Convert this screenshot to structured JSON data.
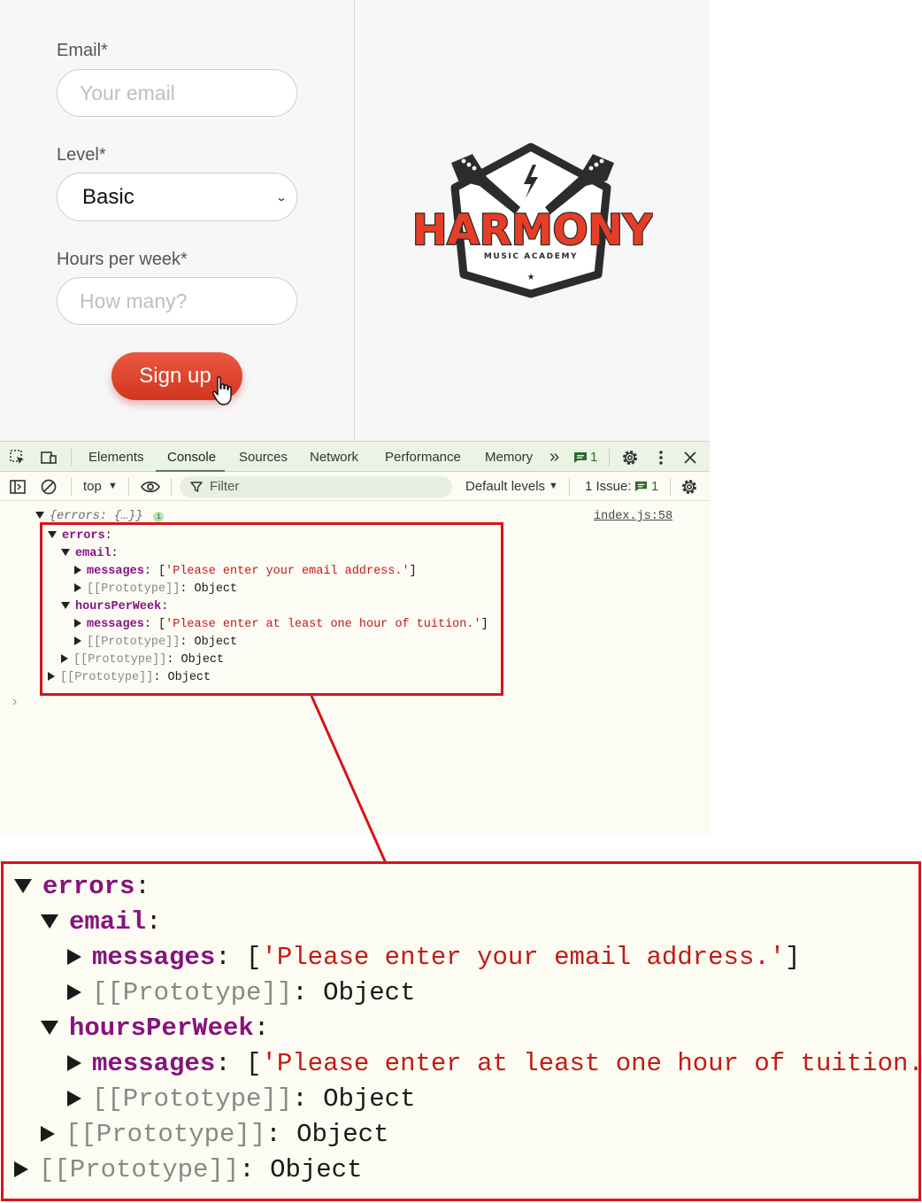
{
  "form": {
    "email_label": "Email*",
    "email_placeholder": "Your email",
    "level_label": "Level*",
    "level_value": "Basic",
    "hours_label": "Hours per week*",
    "hours_placeholder": "How many?",
    "signup_label": "Sign up"
  },
  "logo": {
    "brand": "HARMONY",
    "tagline": "MUSIC ACADEMY",
    "star": "★"
  },
  "devtools": {
    "tabs": [
      "Elements",
      "Console",
      "Sources",
      "Network",
      "Performance",
      "Memory"
    ],
    "active_tab": "Console",
    "more_tabs": "»",
    "message_count": "1",
    "toolbar": {
      "context": "top",
      "filter_placeholder": "Filter",
      "levels": "Default levels",
      "issues_label": "1 Issue:",
      "issues_count": "1"
    },
    "console": {
      "summary": "{errors: {…}}",
      "info_badge": "i",
      "source_link": "index.js:58",
      "prompt": "›",
      "rows": [
        {
          "key": "errors",
          "sep": ":",
          "value": "",
          "kind": "key",
          "arrow": "down",
          "indent": 0
        },
        {
          "key": "email",
          "sep": ":",
          "value": "",
          "kind": "key",
          "arrow": "down",
          "indent": 1
        },
        {
          "key": "messages",
          "sep": ": ",
          "value": "['Please enter your email address.']",
          "kind": "key",
          "arrow": "right",
          "indent": 2
        },
        {
          "key": "[[Prototype]]",
          "sep": ": ",
          "value": "Object",
          "kind": "proto",
          "arrow": "right",
          "indent": 2
        },
        {
          "key": "hoursPerWeek",
          "sep": ":",
          "value": "",
          "kind": "key",
          "arrow": "down",
          "indent": 1
        },
        {
          "key": "messages",
          "sep": ": ",
          "value": "['Please enter at least one hour of tuition.']",
          "kind": "key",
          "arrow": "right",
          "indent": 2
        },
        {
          "key": "[[Prototype]]",
          "sep": ": ",
          "value": "Object",
          "kind": "proto",
          "arrow": "right",
          "indent": 2
        },
        {
          "key": "[[Prototype]]",
          "sep": ": ",
          "value": "Object",
          "kind": "proto",
          "arrow": "right",
          "indent": 1
        },
        {
          "key": "[[Prototype]]",
          "sep": ": ",
          "value": "Object",
          "kind": "proto",
          "arrow": "right",
          "indent": 0
        }
      ]
    }
  },
  "colors": {
    "accent_red": "#e0452c",
    "highlight_border": "#d8141a",
    "devtools_tabbar": "#eaf3e4",
    "console_key": "#881280",
    "console_string": "#c41a16"
  },
  "icons": [
    "inspect-icon",
    "device-toggle-icon",
    "message-icon",
    "gear-icon",
    "kebab-menu-icon",
    "close-icon",
    "sidebar-icon",
    "clear-console-icon",
    "eye-icon",
    "filter-icon",
    "hand-cursor-icon"
  ]
}
